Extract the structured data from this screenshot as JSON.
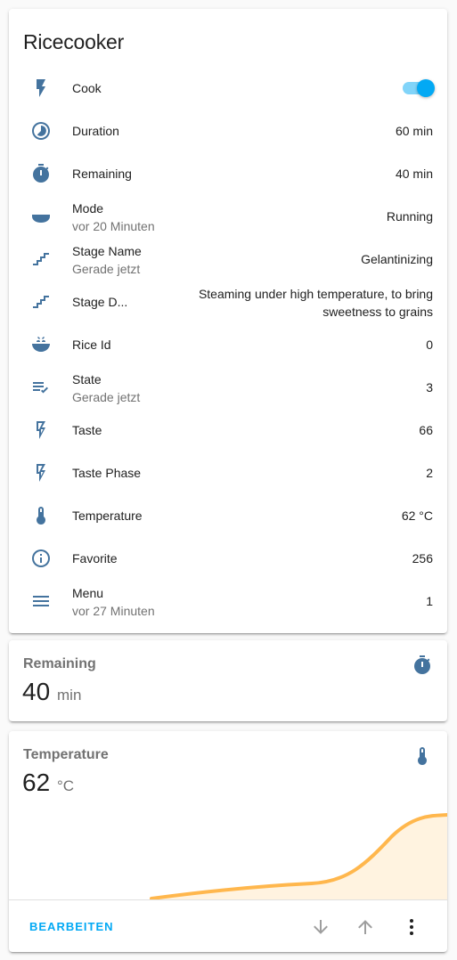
{
  "entities_card": {
    "title": "Ricecooker",
    "rows": [
      {
        "name": "Cook",
        "icon": "flash-icon",
        "toggle": true
      },
      {
        "name": "Duration",
        "icon": "timelapse-icon",
        "value": "60 min"
      },
      {
        "name": "Remaining",
        "icon": "timer-icon",
        "value": "40 min"
      },
      {
        "name": "Mode",
        "icon": "bowl-icon",
        "secondary": "vor 20 Minuten",
        "value": "Running"
      },
      {
        "name": "Stage Name",
        "icon": "stairs-icon",
        "secondary": "Gerade jetzt",
        "value": "Gelantinizing"
      },
      {
        "name": "Stage D...",
        "icon": "stairs-icon",
        "value": "Steaming under high temperature, to bring sweetness to grains"
      },
      {
        "name": "Rice Id",
        "icon": "rice-icon",
        "value": "0"
      },
      {
        "name": "State",
        "icon": "playlist-check-icon",
        "secondary": "Gerade jetzt",
        "value": "3"
      },
      {
        "name": "Taste",
        "icon": "flash-outline-icon",
        "value": "66"
      },
      {
        "name": "Taste Phase",
        "icon": "flash-outline-icon",
        "value": "2"
      },
      {
        "name": "Temperature",
        "icon": "thermometer-icon",
        "value": "62 °C"
      },
      {
        "name": "Favorite",
        "icon": "information-outline-icon",
        "value": "256"
      },
      {
        "name": "Menu",
        "icon": "menu-icon",
        "secondary": "vor 27 Minuten",
        "value": "1"
      }
    ]
  },
  "remaining_card": {
    "name": "Remaining",
    "value": "40",
    "unit": "min",
    "icon": "timer-icon"
  },
  "temperature_card": {
    "name": "Temperature",
    "value": "62",
    "unit": "°C",
    "icon": "thermometer-icon",
    "graph_color": "#ffb74d",
    "graph_fill": "#fff3e0"
  },
  "actions": {
    "edit_label": "BEARBEITEN",
    "icons": [
      "arrow-down-icon",
      "arrow-up-icon",
      "dots-vertical-icon"
    ]
  },
  "colors": {
    "icon": "#44739e",
    "accent": "#03a9f4"
  }
}
